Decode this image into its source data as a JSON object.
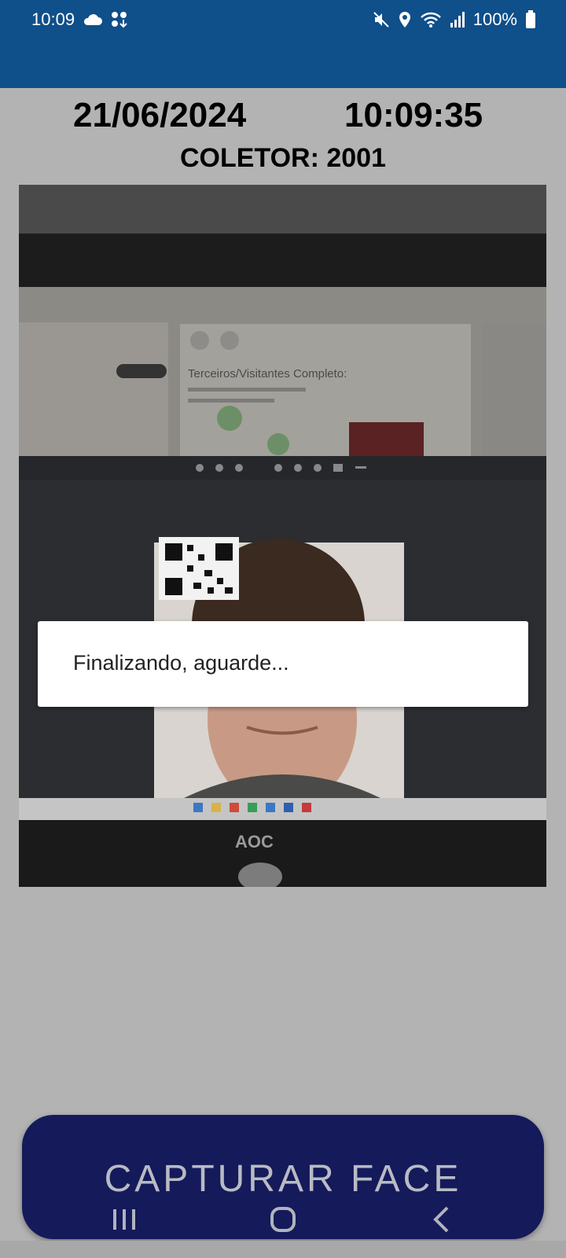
{
  "status_bar": {
    "time": "10:09",
    "battery": "100%",
    "icons": [
      "cloud-icon",
      "apps-download-icon",
      "mute-icon",
      "location-icon",
      "wifi-icon",
      "signal-icon",
      "battery-icon"
    ],
    "background": "#0f4f8a"
  },
  "header": {
    "date": "21/06/2024",
    "time": "10:09:35",
    "collector": "COLETOR: 2001"
  },
  "camera": {
    "screen_title": "Terceiros/Visitantes Completo:",
    "monitor_brand": "AOC"
  },
  "dialog": {
    "message": "Finalizando, aguarde..."
  },
  "button": {
    "capture_label": "CAPTURAR FACE",
    "color": "#141a5a"
  },
  "nav": {
    "icons": [
      "recent-apps-icon",
      "home-icon",
      "back-icon"
    ]
  }
}
